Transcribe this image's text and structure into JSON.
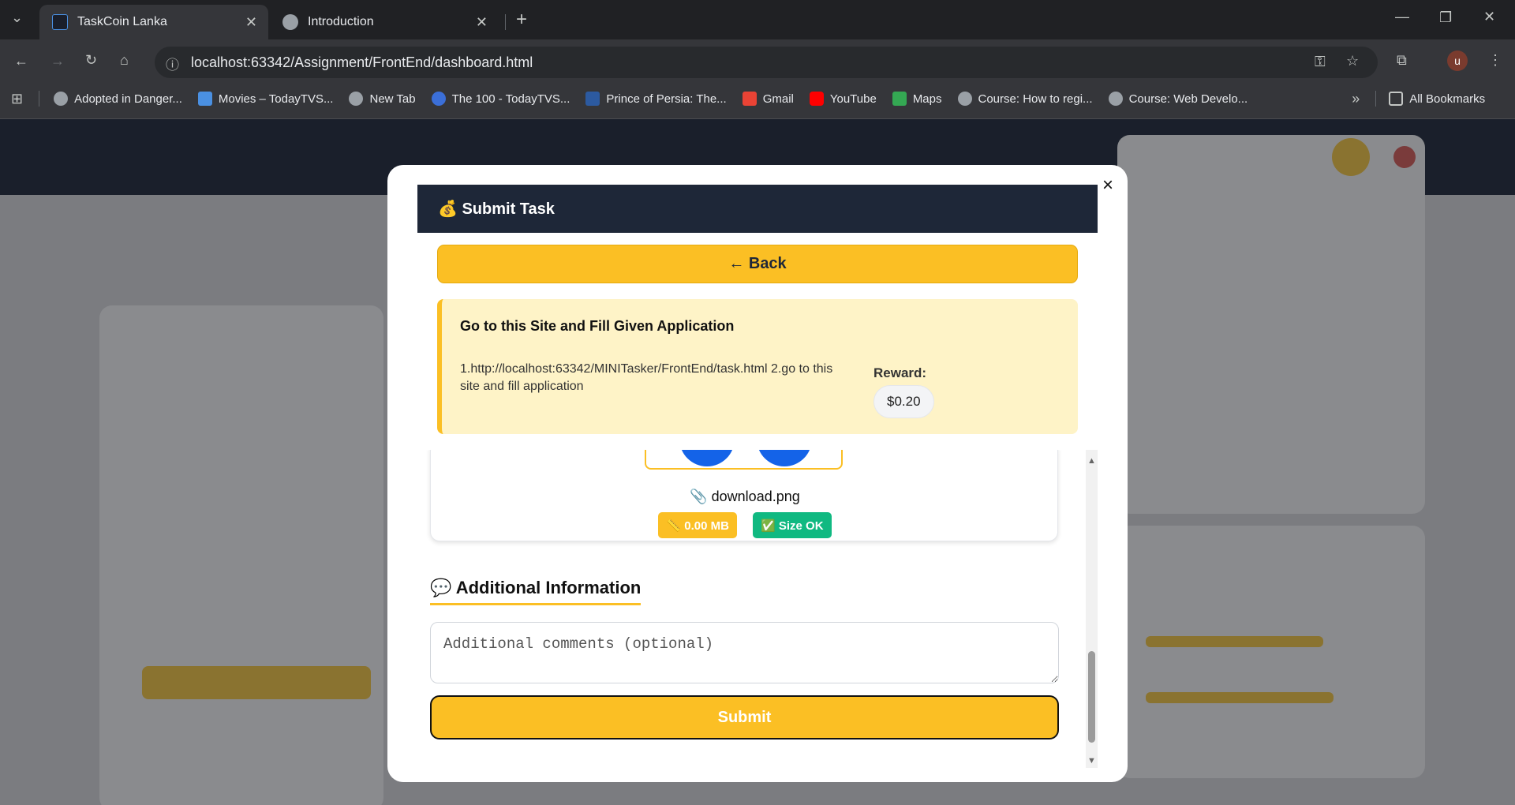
{
  "browser": {
    "tabs": [
      {
        "title": "TaskCoin Lanka",
        "active": true
      },
      {
        "title": "Introduction",
        "active": false
      }
    ],
    "url": "localhost:63342/Assignment/FrontEnd/dashboard.html",
    "bookmarks": [
      "Adopted in Danger...",
      "Movies – TodayTVS...",
      "New Tab",
      "The 100 - TodayTVS...",
      "Prince of Persia: The...",
      "Gmail",
      "YouTube",
      "Maps",
      "Course: How to regi...",
      "Course: Web Develo..."
    ],
    "all_bookmarks": "All Bookmarks",
    "profile_initial": "u"
  },
  "modal": {
    "title": "💰 Submit Task",
    "back_label": "← Back",
    "task": {
      "title": "Go to this Site and Fill Given Application",
      "description": "1.http://localhost:63342/MINITasker/FrontEnd/task.html 2.go to this site and fill application",
      "reward_label": "Reward:",
      "reward_value": "$0.20"
    },
    "file": {
      "name": "📎 download.png",
      "size_badge": "📏 0.00 MB",
      "status_badge": "✅ Size OK"
    },
    "additional": {
      "heading": "💬 Additional Information",
      "placeholder": "Additional comments (optional)"
    },
    "submit_label": "Submit",
    "close_glyph": "×"
  },
  "colors": {
    "accent": "#fbbf24",
    "header": "#1e2738",
    "info_bg": "#fef3c7",
    "success": "#10b981"
  }
}
